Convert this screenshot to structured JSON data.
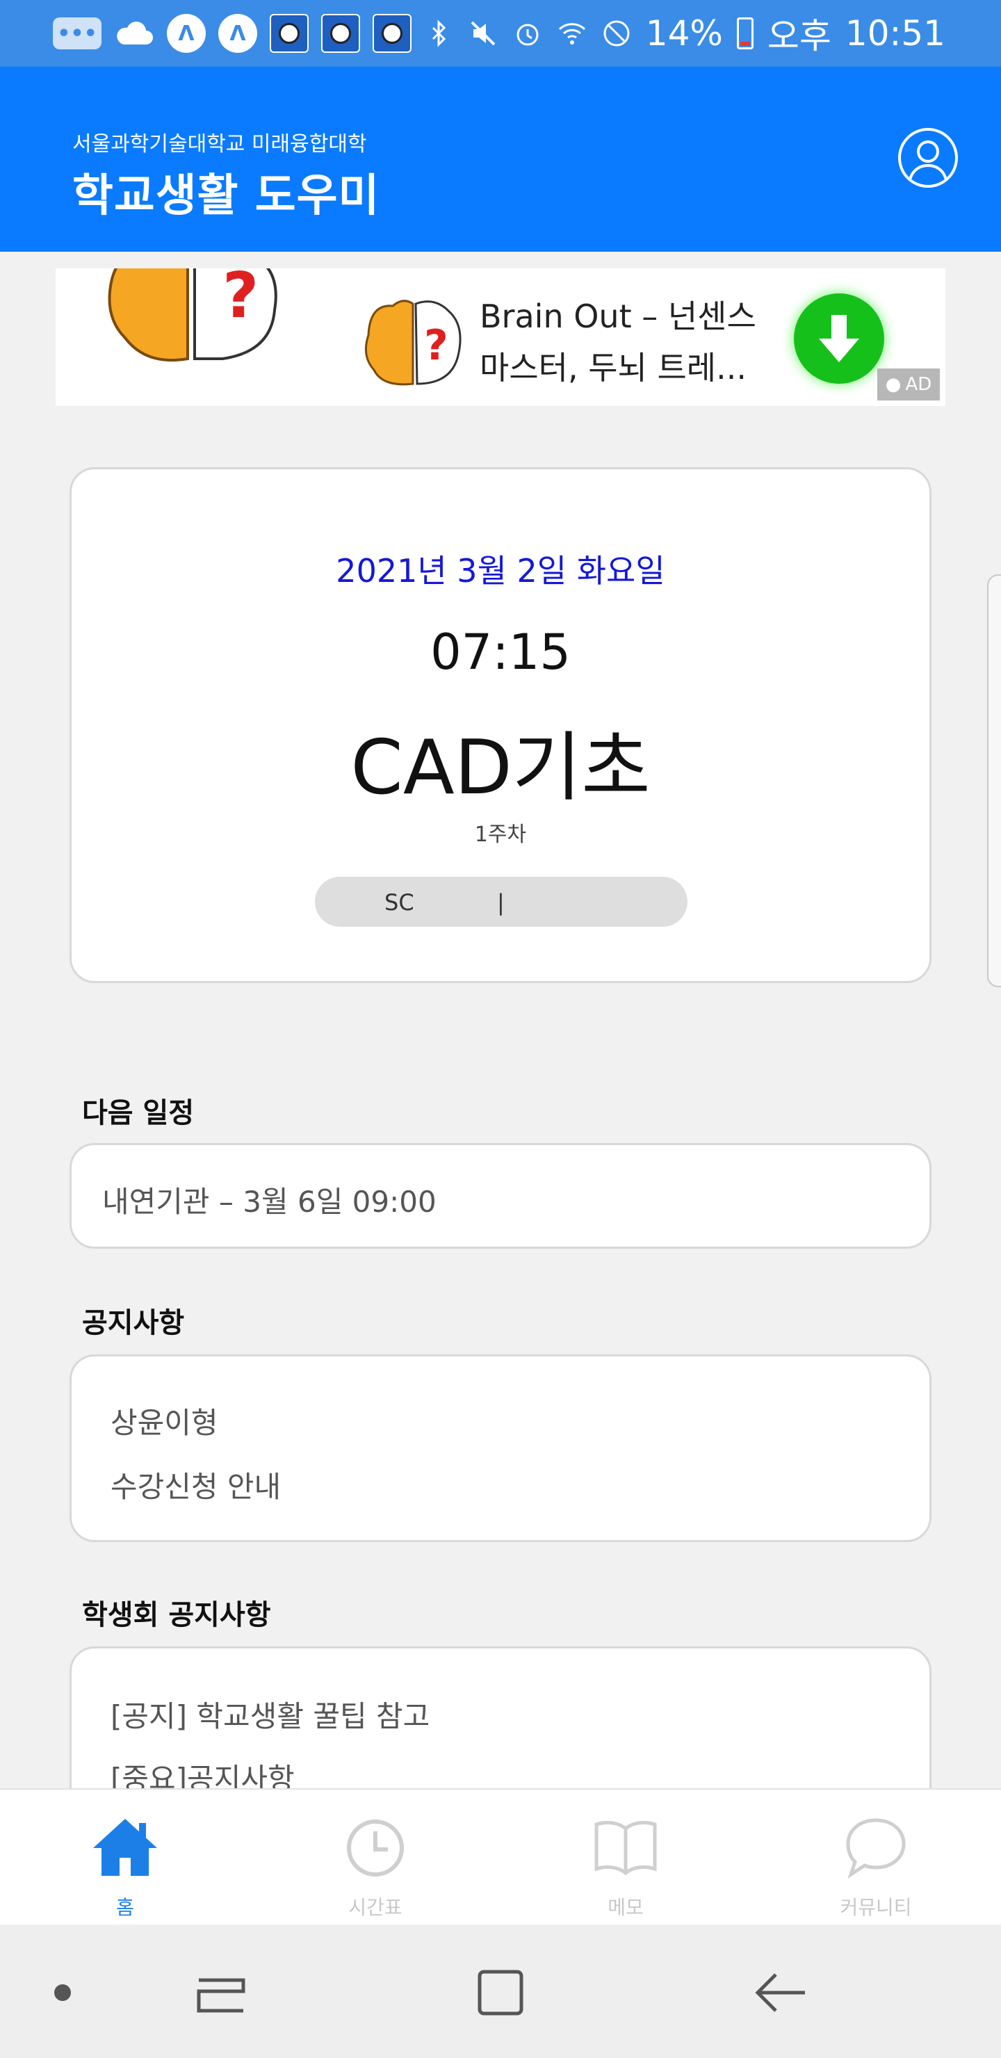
{
  "status_bar": {
    "battery": "14%",
    "ampm": "오후",
    "time": "10:51",
    "icons": [
      "message-icon",
      "cloud-icon",
      "naver-icon",
      "naver-icon",
      "app-notification-icon",
      "app-notification-icon",
      "app-notification-icon",
      "bluetooth-icon",
      "mute-icon",
      "alarm-icon",
      "wifi-icon",
      "do-not-disturb-icon",
      "battery-icon"
    ]
  },
  "header": {
    "school": "서울과학기술대학교 미래융합대학",
    "title": "학교생활 도우미"
  },
  "ad": {
    "title": "Brain Out – 넌센스 마스터, 두뇌 트레...",
    "badge": "AD"
  },
  "current_class": {
    "date": "2021년 3월 2일 화요일",
    "time": "07:15",
    "subject": "CAD기초",
    "week": "1주차",
    "room_code": "SC",
    "room_sep": "|"
  },
  "sections": {
    "next_schedule": {
      "label": "다음 일정",
      "item": "내연기관 – 3월 6일 09:00"
    },
    "notices": {
      "label": "공지사항",
      "items": [
        "상윤이형",
        "수강신청 안내"
      ]
    },
    "student_council": {
      "label": "학생회 공지사항",
      "items": [
        "[공지] 학교생활 꿀팁 참고",
        "[중요]공지사항"
      ]
    }
  },
  "bottom_nav": {
    "items": [
      {
        "label": "홈",
        "icon": "home-icon",
        "active": true
      },
      {
        "label": "시간표",
        "icon": "clock-icon",
        "active": false
      },
      {
        "label": "메모",
        "icon": "book-icon",
        "active": false
      },
      {
        "label": "커뮤니티",
        "icon": "chat-bubble-icon",
        "active": false
      }
    ]
  },
  "colors": {
    "status_bar": "#3a8ce6",
    "app_bar": "#0a7bff",
    "date_text": "#1418d6",
    "active_nav": "#1c7fe8",
    "inactive_nav": "#c8c8c8"
  }
}
